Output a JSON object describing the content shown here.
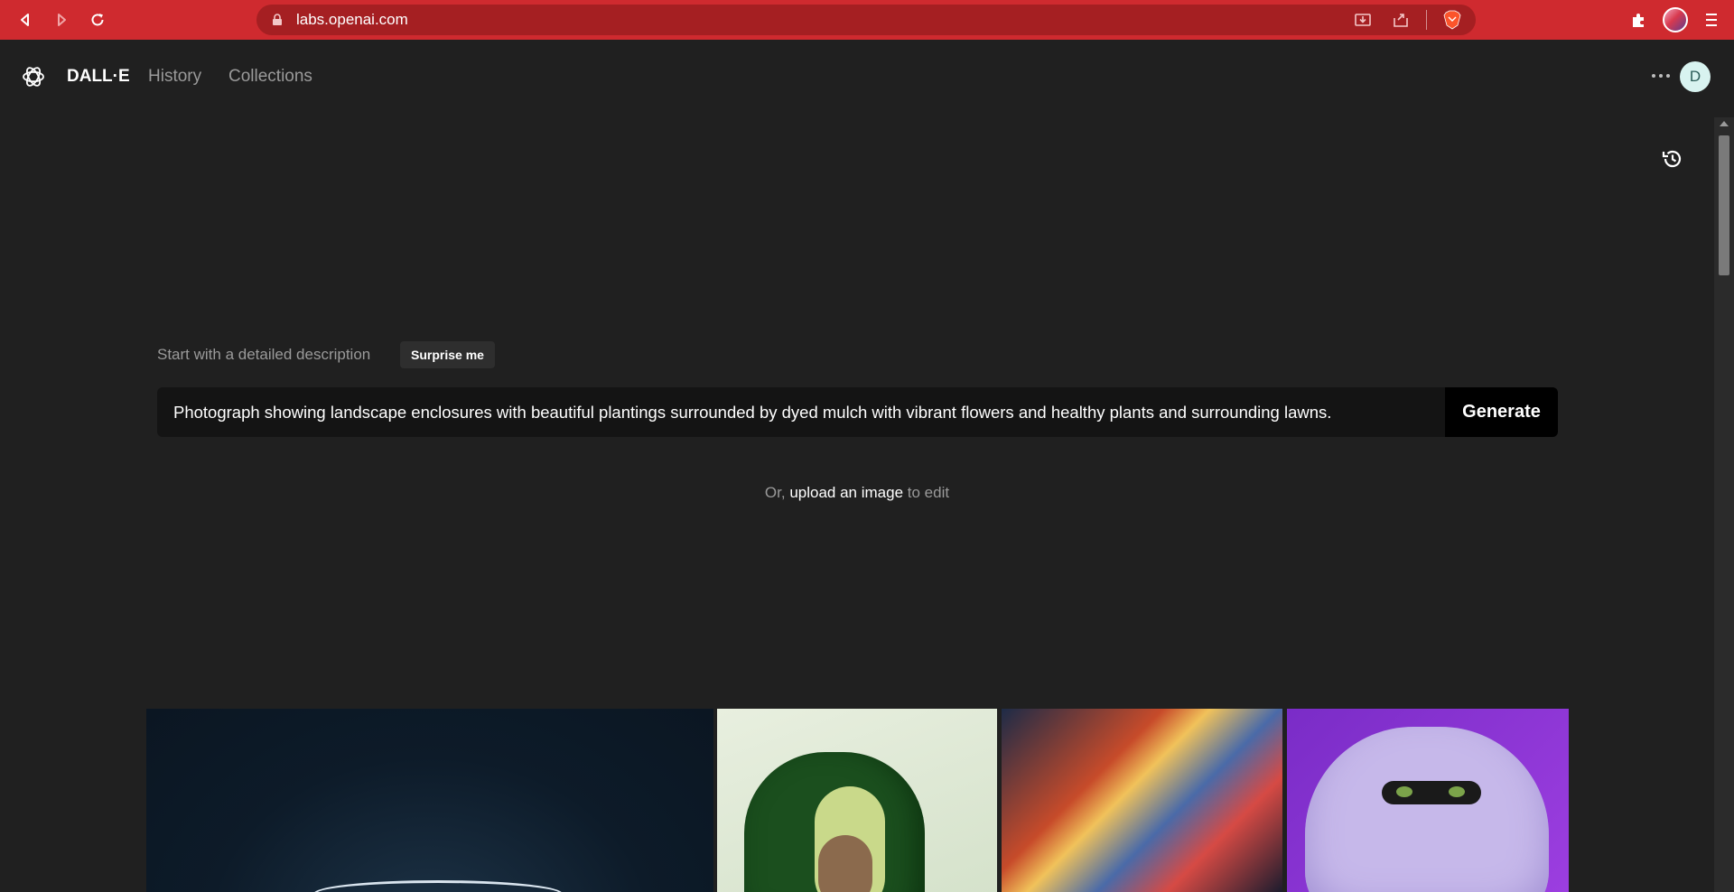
{
  "browser": {
    "url": "labs.openai.com"
  },
  "header": {
    "brand": "DALL·E",
    "nav": [
      "History",
      "Collections"
    ],
    "avatar_initial": "D"
  },
  "prompt": {
    "label": "Start with a detailed description",
    "surprise_label": "Surprise me",
    "value": "Photograph showing landscape enclosures with beautiful plantings surrounded by dyed mulch with vibrant flowers and healthy plants and surrounding lawns.",
    "generate_label": "Generate"
  },
  "upload": {
    "prefix": "Or,",
    "link": "upload an image",
    "suffix": "to edit"
  },
  "colors": {
    "chrome": "#cf2a2f",
    "background": "#202020",
    "input": "#141414"
  }
}
